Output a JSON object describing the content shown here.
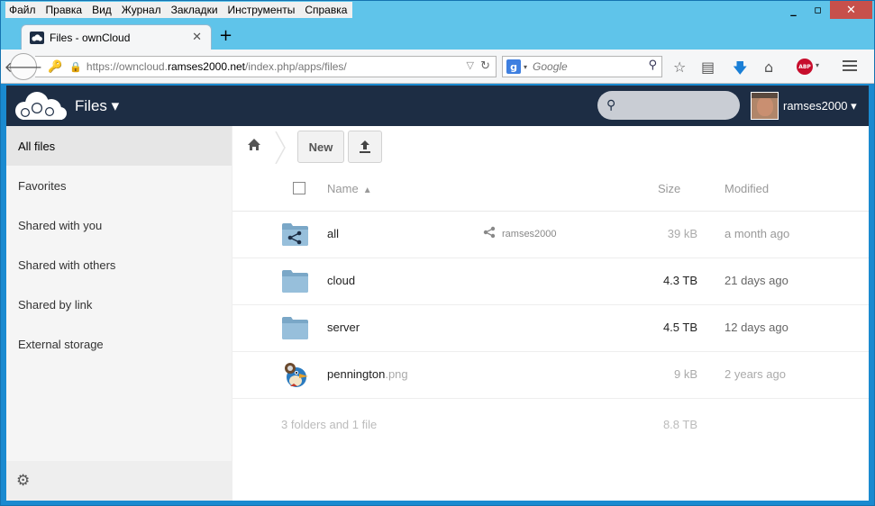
{
  "browser": {
    "menu": [
      "Файл",
      "Правка",
      "Вид",
      "Журнал",
      "Закладки",
      "Инструменты",
      "Справка"
    ],
    "tab_title": "Files - ownCloud",
    "url_prefix": "https://owncloud.",
    "url_domain": "ramses2000.net",
    "url_path": "/index.php/apps/files/",
    "search_placeholder": "Google",
    "accent": "#1a8ad0"
  },
  "header": {
    "app_title": "Files ▾",
    "username": "ramses2000 ▾",
    "bg_color": "#1d2d44"
  },
  "sidebar": {
    "items": [
      {
        "label": "All files"
      },
      {
        "label": "Favorites"
      },
      {
        "label": "Shared with you"
      },
      {
        "label": "Shared with others"
      },
      {
        "label": "Shared by link"
      },
      {
        "label": "External storage"
      }
    ]
  },
  "controls": {
    "new_label": "New"
  },
  "table": {
    "headers": {
      "name": "Name",
      "size": "Size",
      "modified": "Modified"
    },
    "rows": [
      {
        "name": "all",
        "ext": "",
        "type": "shared-folder",
        "shared_with": "ramses2000",
        "size": "39 kB",
        "modified": "a month ago",
        "size_color": "#aaaaaa"
      },
      {
        "name": "cloud",
        "ext": "",
        "type": "folder",
        "shared_with": "",
        "size": "4.3 TB",
        "modified": "21 days ago",
        "size_color": "#222222"
      },
      {
        "name": "server",
        "ext": "",
        "type": "folder",
        "shared_with": "",
        "size": "4.5 TB",
        "modified": "12 days ago",
        "size_color": "#222222"
      },
      {
        "name": "pennington",
        "ext": ".png",
        "type": "image",
        "shared_with": "",
        "size": "9 kB",
        "modified": "2 years ago",
        "size_color": "#aaaaaa"
      }
    ],
    "summary_count": "3 folders and 1 file",
    "summary_size": "8.8 TB"
  }
}
